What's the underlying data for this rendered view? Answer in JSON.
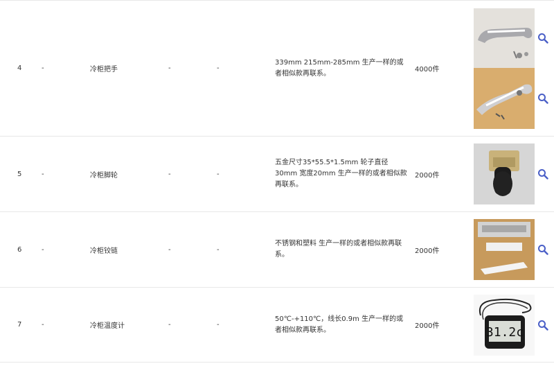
{
  "rows": [
    {
      "no": "4",
      "col2": "-",
      "name": "冷柜把手",
      "col4": "-",
      "col5": "-",
      "spec": "339mm 215mm-285mm 生产一样的或者相似款再联系。",
      "qty": "4000件",
      "images": [
        "handle-chrome-photo",
        "handle-chrome-photo-2"
      ]
    },
    {
      "no": "5",
      "col2": "-",
      "name": "冷柜脚轮",
      "col4": "-",
      "col5": "-",
      "spec": "五金尺寸35*55.5*1.5mm 轮子直径30mm 宽度20mm 生产一样的或者相似款再联系。",
      "qty": "2000件",
      "images": [
        "caster-wheel-photo"
      ]
    },
    {
      "no": "6",
      "col2": "-",
      "name": "冷柜铰链",
      "col4": "-",
      "col5": "-",
      "spec": "不锈钢和塑料 生产一样的或者相似款再联系。",
      "qty": "2000件",
      "images": [
        "hinge-parts-photo"
      ]
    },
    {
      "no": "7",
      "col2": "-",
      "name": "冷柜温度计",
      "col4": "-",
      "col5": "-",
      "spec": "50℃-+110℃，线长0.9m 生产一样的或者相似款再联系。",
      "qty": "2000件",
      "images": [
        "digital-thermometer-photo"
      ],
      "thermometer_reading": "31.2c"
    }
  ],
  "colors": {
    "zoom_icon": "#4a5fc7",
    "border": "#e7e7e7",
    "text": "#333333"
  }
}
